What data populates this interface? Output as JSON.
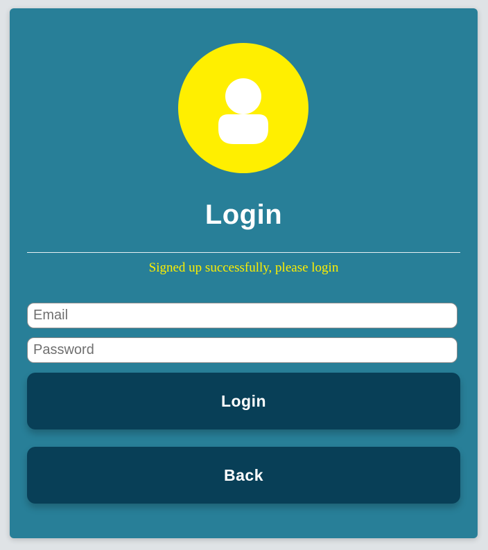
{
  "colors": {
    "page_background": "#dfe3e6",
    "card_background": "#287f98",
    "avatar_background": "#ffef00",
    "status_text": "#ffef00",
    "button_background": "#083f57",
    "text_light": "#ffffff"
  },
  "avatar": {
    "icon": "user-icon"
  },
  "login_form": {
    "title": "Login",
    "status_message": "Signed up successfully, please login",
    "email_placeholder": "Email",
    "email_value": "",
    "password_placeholder": "Password",
    "password_value": "",
    "login_button_label": "Login",
    "back_button_label": "Back"
  }
}
